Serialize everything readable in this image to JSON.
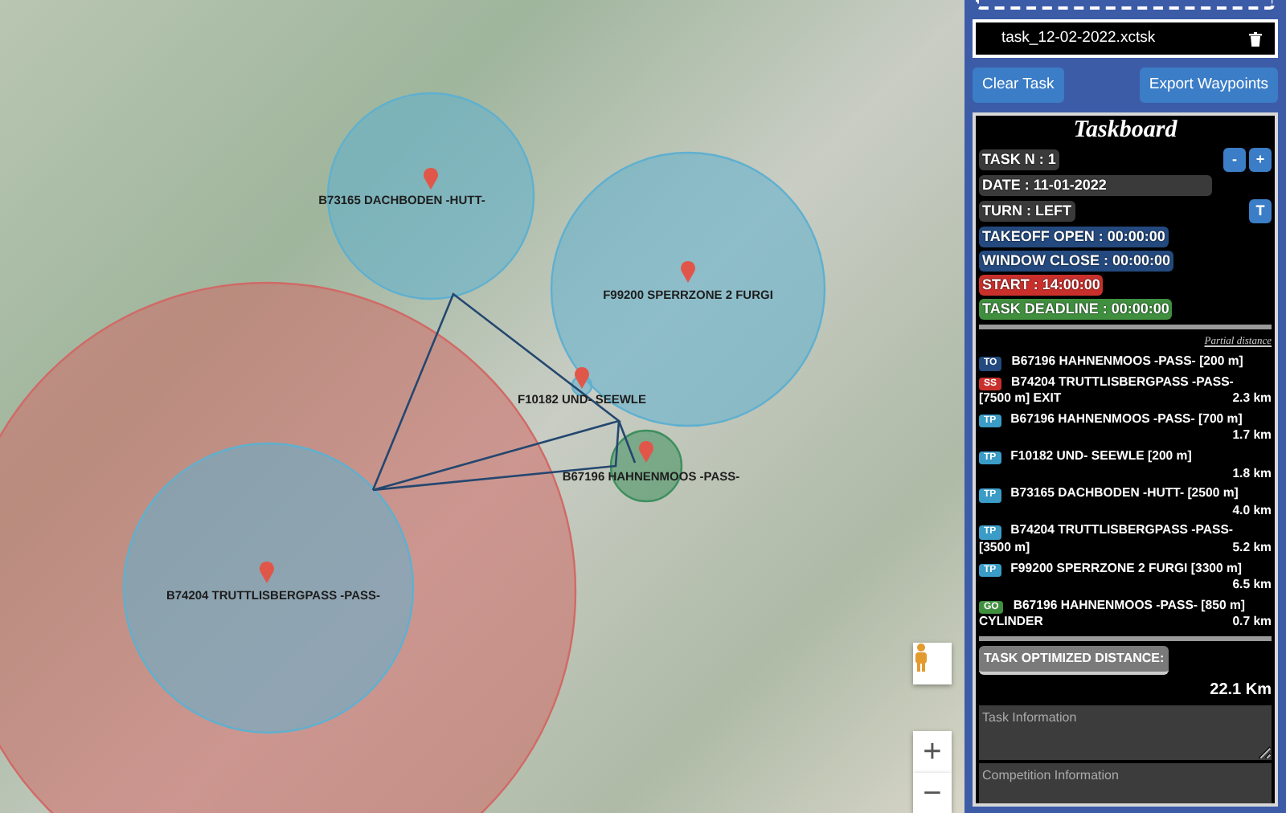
{
  "map": {
    "waypoints": [
      {
        "label": "B73165 DACHBODEN -HUTT-",
        "color": "#5fb0cf"
      },
      {
        "label": "F99200 SPERRZONE 2 FURGI",
        "color": "#5fb0cf"
      },
      {
        "color": "#d06a66"
      },
      {
        "label": "B74204 TRUTTLISBERGPASS -PASS-",
        "color": "#5fb0cf"
      },
      {
        "label": "F10182 UND- SEEWLE",
        "color": "#5fb0cf"
      },
      {
        "label": "B67196 HAHNENMOOS -PASS-",
        "color": "#3f8f5e"
      }
    ],
    "zoom_in": "+",
    "zoom_out": "−"
  },
  "task_file": {
    "name": "task_12-02-2022.xctsk"
  },
  "buttons": [
    {
      "label": "Clear Task"
    },
    {
      "label": "Export Waypoints"
    }
  ],
  "taskboard": {
    "title": "Taskboard",
    "info": [
      {
        "text": "TASK N : 1",
        "kind": "plain",
        "buttons": [
          "-",
          "+"
        ]
      },
      {
        "text": "DATE : 11-01-2022",
        "kind": "wide"
      },
      {
        "text": "TURN : LEFT",
        "kind": "plain",
        "buttons": [
          "T"
        ]
      },
      {
        "text": "TAKEOFF OPEN : 00:00:00",
        "kind": "blue"
      },
      {
        "text": "WINDOW CLOSE : 00:00:00",
        "kind": "blue"
      },
      {
        "text": "START : 14:00:00",
        "kind": "red"
      },
      {
        "text": "TASK DEADLINE : 00:00:00",
        "kind": "green"
      }
    ],
    "partial_label": "Partial distance",
    "turnpoints": [
      {
        "type": "TO",
        "name": "B67196 HAHNENMOOS -PASS- [200 m]"
      },
      {
        "type": "SS",
        "name": "B74204 TRUTTLISBERGPASS -PASS-",
        "detail": "[7500 m] EXIT",
        "distance": "2.3 km"
      },
      {
        "type": "TP",
        "name": "B67196 HAHNENMOOS -PASS- [700 m]",
        "distance": "1.7 km"
      },
      {
        "type": "TP",
        "name": "F10182 UND- SEEWLE [200 m]",
        "distance": "1.8 km"
      },
      {
        "type": "TP",
        "name": "B73165 DACHBODEN -HUTT- [2500 m]",
        "distance": "4.0 km"
      },
      {
        "type": "TP",
        "name": "B74204 TRUTTLISBERGPASS -PASS-",
        "detail": "[3500 m]",
        "distance": "5.2 km"
      },
      {
        "type": "TP",
        "name": "F99200 SPERRZONE 2 FURGI [3300 m]",
        "distance": "6.5 km"
      },
      {
        "type": "GO",
        "name": "B67196 HAHNENMOOS -PASS- [850 m]",
        "detail": "CYLINDER",
        "distance": "0.7 km"
      }
    ],
    "optimized_label": "TASK OPTIMIZED DISTANCE:",
    "optimized_distance": "22.1 Km",
    "task_info": {
      "placeholder": "Task Information"
    },
    "competition_info": {
      "placeholder": "Competition Information"
    }
  }
}
